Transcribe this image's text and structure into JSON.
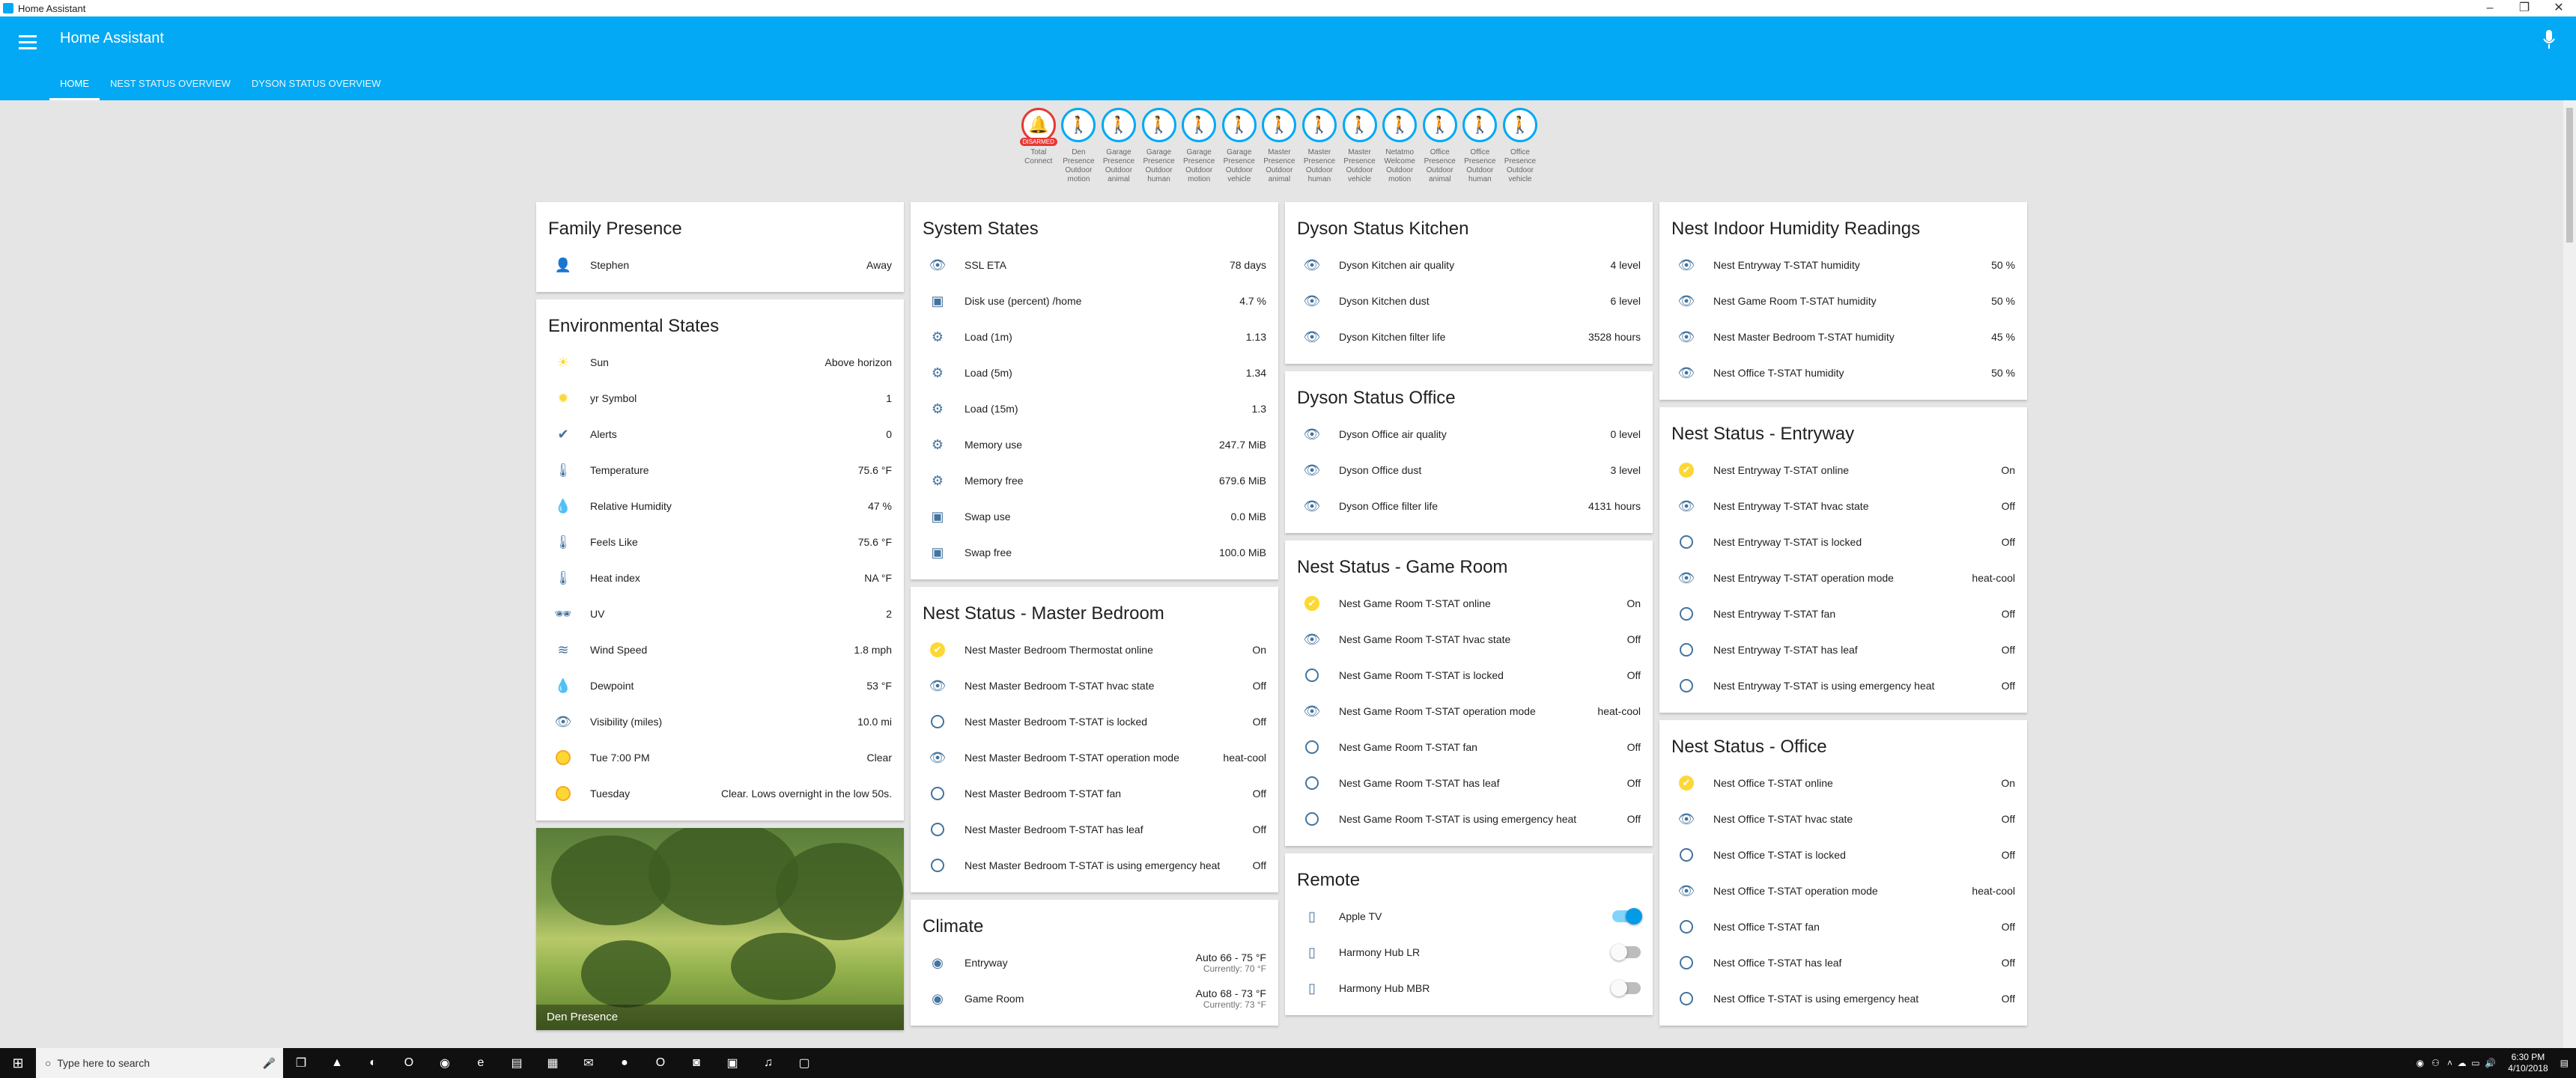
{
  "window": {
    "title": "Home Assistant",
    "controls": [
      "–",
      "❐",
      "✕"
    ]
  },
  "app": {
    "title": "Home Assistant",
    "tabs": [
      {
        "label": "HOME",
        "active": true
      },
      {
        "label": "NEST STATUS OVERVIEW",
        "active": false
      },
      {
        "label": "DYSON STATUS OVERVIEW",
        "active": false
      }
    ],
    "accent": "#03a9f4"
  },
  "badges": [
    {
      "label": "Total Connect",
      "icon": "bell-icon",
      "state": "DISARMED",
      "alarm": true
    },
    {
      "label": "Den Presence Outdoor motion",
      "icon": "walk-icon"
    },
    {
      "label": "Garage Presence Outdoor animal",
      "icon": "walk-icon"
    },
    {
      "label": "Garage Presence Outdoor human",
      "icon": "walk-icon"
    },
    {
      "label": "Garage Presence Outdoor motion",
      "icon": "walk-icon"
    },
    {
      "label": "Garage Presence Outdoor vehicle",
      "icon": "walk-icon"
    },
    {
      "label": "Master Presence Outdoor animal",
      "icon": "walk-icon"
    },
    {
      "label": "Master Presence Outdoor human",
      "icon": "walk-icon"
    },
    {
      "label": "Master Presence Outdoor vehicle",
      "icon": "walk-icon"
    },
    {
      "label": "Netatmo Welcome Outdoor motion",
      "icon": "walk-icon"
    },
    {
      "label": "Office Presence Outdoor animal",
      "icon": "walk-icon"
    },
    {
      "label": "Office Presence Outdoor human",
      "icon": "walk-icon"
    },
    {
      "label": "Office Presence Outdoor vehicle",
      "icon": "walk-icon"
    }
  ],
  "columns": [
    {
      "cards": [
        {
          "title": "Family Presence",
          "rows": [
            {
              "icon": "account-icon",
              "glyph": "👤",
              "name": "Stephen",
              "state": "Away"
            }
          ]
        },
        {
          "title": "Environmental States",
          "rows": [
            {
              "icon": "sun-icon",
              "glyph": "☀",
              "on": true,
              "name": "Sun",
              "state": "Above horizon"
            },
            {
              "icon": "weather-symbol-icon",
              "glyph": "✹",
              "on": true,
              "name": "yr Symbol",
              "state": "1"
            },
            {
              "icon": "check-circle-icon",
              "glyph": "✔",
              "name": "Alerts",
              "state": "0"
            },
            {
              "icon": "thermometer-icon",
              "glyph": "🌡",
              "name": "Temperature",
              "state": "75.6 °F"
            },
            {
              "icon": "water-percent-icon",
              "glyph": "💧",
              "name": "Relative Humidity",
              "state": "47 %"
            },
            {
              "icon": "thermometer-icon",
              "glyph": "🌡",
              "name": "Feels Like",
              "state": "75.6 °F"
            },
            {
              "icon": "thermometer-icon",
              "glyph": "🌡",
              "name": "Heat index",
              "state": "NA °F"
            },
            {
              "icon": "sunglasses-icon",
              "glyph": "🕶",
              "name": "UV",
              "state": "2"
            },
            {
              "icon": "wind-icon",
              "glyph": "≋",
              "name": "Wind Speed",
              "state": "1.8 mph"
            },
            {
              "icon": "water-icon",
              "glyph": "💧",
              "name": "Dewpoint",
              "state": "53 °F"
            },
            {
              "icon": "eye-icon",
              "glyph": "👁",
              "name": "Visibility (miles)",
              "state": "10.0 mi"
            },
            {
              "icon": "sun-forecast-icon",
              "dot": true,
              "name": "Tue 7:00 PM",
              "state": "Clear"
            },
            {
              "icon": "sun-forecast-icon",
              "dot": true,
              "name": "Tuesday",
              "state": "Clear. Lows overnight in the low 50s."
            }
          ]
        }
      ],
      "camera": {
        "caption": "Den Presence"
      }
    },
    {
      "cards": [
        {
          "title": "System States",
          "rows": [
            {
              "icon": "eye-icon",
              "glyph": "👁",
              "name": "SSL ETA",
              "state": "78 days"
            },
            {
              "icon": "harddisk-icon",
              "glyph": "▣",
              "name": "Disk use (percent) /home",
              "state": "4.7 %"
            },
            {
              "icon": "chip-icon",
              "glyph": "⚙",
              "name": "Load (1m)",
              "state": "1.13"
            },
            {
              "icon": "chip-icon",
              "glyph": "⚙",
              "name": "Load (5m)",
              "state": "1.34"
            },
            {
              "icon": "chip-icon",
              "glyph": "⚙",
              "name": "Load (15m)",
              "state": "1.3"
            },
            {
              "icon": "memory-icon",
              "glyph": "⚙",
              "name": "Memory use",
              "state": "247.7 MiB"
            },
            {
              "icon": "memory-icon",
              "glyph": "⚙",
              "name": "Memory free",
              "state": "679.6 MiB"
            },
            {
              "icon": "harddisk-icon",
              "glyph": "▣",
              "name": "Swap use",
              "state": "0.0 MiB"
            },
            {
              "icon": "harddisk-icon",
              "glyph": "▣",
              "name": "Swap free",
              "state": "100.0 MiB"
            }
          ]
        },
        {
          "title": "Nest Status - Master Bedroom",
          "rows": [
            {
              "icon": "check-circle-icon",
              "check": true,
              "name": "Nest Master Bedroom Thermostat online",
              "state": "On"
            },
            {
              "icon": "eye-icon",
              "glyph": "👁",
              "name": "Nest Master Bedroom T-STAT hvac state",
              "state": "Off"
            },
            {
              "icon": "circle-outline-icon",
              "circle": true,
              "name": "Nest Master Bedroom T-STAT is locked",
              "state": "Off"
            },
            {
              "icon": "eye-icon",
              "glyph": "👁",
              "name": "Nest Master Bedroom T-STAT operation mode",
              "state": "heat-cool"
            },
            {
              "icon": "circle-outline-icon",
              "circle": true,
              "name": "Nest Master Bedroom T-STAT fan",
              "state": "Off"
            },
            {
              "icon": "circle-outline-icon",
              "circle": true,
              "name": "Nest Master Bedroom T-STAT has leaf",
              "state": "Off"
            },
            {
              "icon": "circle-outline-icon",
              "circle": true,
              "name": "Nest Master Bedroom T-STAT is using emergency heat",
              "state": "Off"
            }
          ]
        },
        {
          "title": "Climate",
          "rows": [
            {
              "icon": "thermostat-icon",
              "glyph": "◉",
              "name": "Entryway",
              "state": "Auto 66 - 75 °F",
              "sub": "Currently: 70 °F"
            },
            {
              "icon": "thermostat-icon",
              "glyph": "◉",
              "name": "Game Room",
              "state": "Auto 68 - 73 °F",
              "sub": "Currently: 73 °F"
            }
          ]
        }
      ]
    },
    {
      "cards": [
        {
          "title": "Dyson Status Kitchen",
          "rows": [
            {
              "icon": "eye-icon",
              "glyph": "👁",
              "name": "Dyson Kitchen air quality",
              "state": "4 level"
            },
            {
              "icon": "eye-icon",
              "glyph": "👁",
              "name": "Dyson Kitchen dust",
              "state": "6 level"
            },
            {
              "icon": "eye-icon",
              "glyph": "👁",
              "name": "Dyson Kitchen filter life",
              "state": "3528 hours"
            }
          ]
        },
        {
          "title": "Dyson Status Office",
          "rows": [
            {
              "icon": "eye-icon",
              "glyph": "👁",
              "name": "Dyson Office air quality",
              "state": "0 level"
            },
            {
              "icon": "eye-icon",
              "glyph": "👁",
              "name": "Dyson Office dust",
              "state": "3 level"
            },
            {
              "icon": "eye-icon",
              "glyph": "👁",
              "name": "Dyson Office filter life",
              "state": "4131 hours"
            }
          ]
        },
        {
          "title": "Nest Status - Game Room",
          "rows": [
            {
              "icon": "check-circle-icon",
              "check": true,
              "name": "Nest Game Room T-STAT online",
              "state": "On"
            },
            {
              "icon": "eye-icon",
              "glyph": "👁",
              "name": "Nest Game Room T-STAT hvac state",
              "state": "Off"
            },
            {
              "icon": "circle-outline-icon",
              "circle": true,
              "name": "Nest Game Room T-STAT is locked",
              "state": "Off"
            },
            {
              "icon": "eye-icon",
              "glyph": "👁",
              "name": "Nest Game Room T-STAT operation mode",
              "state": "heat-cool"
            },
            {
              "icon": "circle-outline-icon",
              "circle": true,
              "name": "Nest Game Room T-STAT fan",
              "state": "Off"
            },
            {
              "icon": "circle-outline-icon",
              "circle": true,
              "name": "Nest Game Room T-STAT has leaf",
              "state": "Off"
            },
            {
              "icon": "circle-outline-icon",
              "circle": true,
              "name": "Nest Game Room T-STAT is using emergency heat",
              "state": "Off"
            }
          ]
        },
        {
          "title": "Remote",
          "rows": [
            {
              "icon": "remote-icon",
              "glyph": "▯",
              "name": "Apple TV",
              "toggle": true,
              "on_state": true
            },
            {
              "icon": "remote-icon",
              "glyph": "▯",
              "name": "Harmony Hub LR",
              "toggle": true,
              "on_state": false
            },
            {
              "icon": "remote-icon",
              "glyph": "▯",
              "name": "Harmony Hub MBR",
              "toggle": true,
              "on_state": false
            }
          ]
        }
      ]
    },
    {
      "cards": [
        {
          "title": "Nest Indoor Humidity Readings",
          "rows": [
            {
              "icon": "eye-icon",
              "glyph": "👁",
              "name": "Nest Entryway T-STAT humidity",
              "state": "50 %"
            },
            {
              "icon": "eye-icon",
              "glyph": "👁",
              "name": "Nest Game Room T-STAT humidity",
              "state": "50 %"
            },
            {
              "icon": "eye-icon",
              "glyph": "👁",
              "name": "Nest Master Bedroom T-STAT humidity",
              "state": "45 %"
            },
            {
              "icon": "eye-icon",
              "glyph": "👁",
              "name": "Nest Office T-STAT humidity",
              "state": "50 %"
            }
          ]
        },
        {
          "title": "Nest Status - Entryway",
          "rows": [
            {
              "icon": "check-circle-icon",
              "check": true,
              "name": "Nest Entryway T-STAT online",
              "state": "On"
            },
            {
              "icon": "eye-icon",
              "glyph": "👁",
              "name": "Nest Entryway T-STAT hvac state",
              "state": "Off"
            },
            {
              "icon": "circle-outline-icon",
              "circle": true,
              "name": "Nest Entryway T-STAT is locked",
              "state": "Off"
            },
            {
              "icon": "eye-icon",
              "glyph": "👁",
              "name": "Nest Entryway T-STAT operation mode",
              "state": "heat-cool"
            },
            {
              "icon": "circle-outline-icon",
              "circle": true,
              "name": "Nest Entryway T-STAT fan",
              "state": "Off"
            },
            {
              "icon": "circle-outline-icon",
              "circle": true,
              "name": "Nest Entryway T-STAT has leaf",
              "state": "Off"
            },
            {
              "icon": "circle-outline-icon",
              "circle": true,
              "name": "Nest Entryway T-STAT is using emergency heat",
              "state": "Off"
            }
          ]
        },
        {
          "title": "Nest Status - Office",
          "rows": [
            {
              "icon": "check-circle-icon",
              "check": true,
              "name": "Nest Office T-STAT online",
              "state": "On"
            },
            {
              "icon": "eye-icon",
              "glyph": "👁",
              "name": "Nest Office T-STAT hvac state",
              "state": "Off"
            },
            {
              "icon": "circle-outline-icon",
              "circle": true,
              "name": "Nest Office T-STAT is locked",
              "state": "Off"
            },
            {
              "icon": "eye-icon",
              "glyph": "👁",
              "name": "Nest Office T-STAT operation mode",
              "state": "heat-cool"
            },
            {
              "icon": "circle-outline-icon",
              "circle": true,
              "name": "Nest Office T-STAT fan",
              "state": "Off"
            },
            {
              "icon": "circle-outline-icon",
              "circle": true,
              "name": "Nest Office T-STAT has leaf",
              "state": "Off"
            },
            {
              "icon": "circle-outline-icon",
              "circle": true,
              "name": "Nest Office T-STAT is using emergency heat",
              "state": "Off"
            }
          ]
        }
      ]
    }
  ],
  "taskbar": {
    "search_placeholder": "Type here to search",
    "time": "6:30 PM",
    "date": "4/10/2018"
  }
}
